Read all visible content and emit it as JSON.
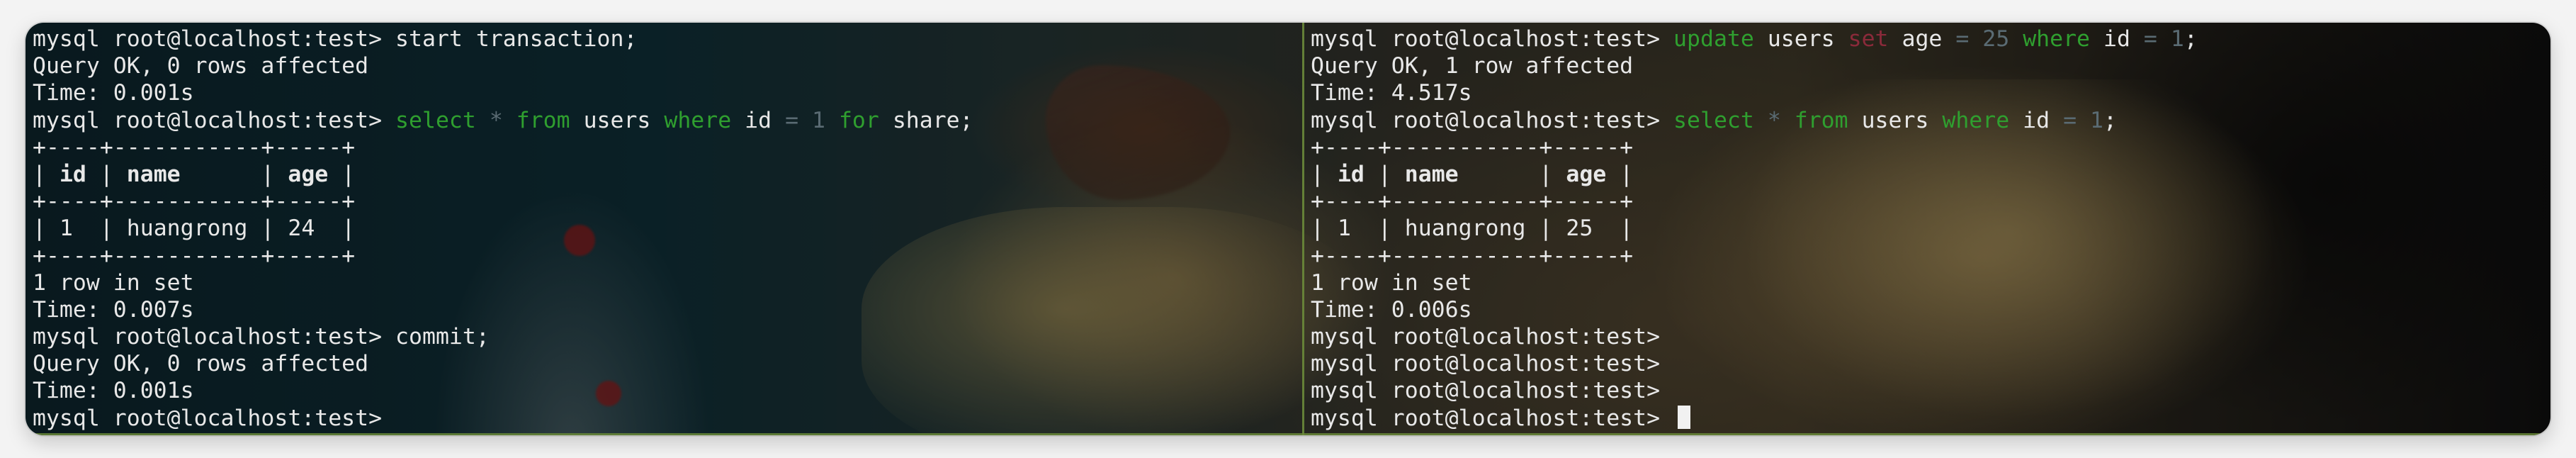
{
  "colors": {
    "text": "#e8e8e8",
    "keyword": "#2f9f2f",
    "number": "#5a6b73",
    "set_keyword": "#8a2a3a",
    "divider": "#6a8a3a",
    "cursor": "#f1f1f1"
  },
  "left": {
    "p1": "mysql root@localhost:test> ",
    "c1": "start transaction;",
    "o1": "Query OK, 0 rows affected",
    "t1": "Time: 0.001s",
    "p2": "mysql root@localhost:test> ",
    "q_select": "select",
    "q_star": "*",
    "q_from": "from",
    "q_users": "users",
    "q_where": "where",
    "q_id": "id",
    "q_eq": "=",
    "q_one": "1",
    "q_for": "for",
    "q_share": "share;",
    "border1": "+----+-----------+-----+",
    "h_id": "id",
    "h_name": "name",
    "h_age": "age",
    "border2": "+----+-----------+-----+",
    "r_id": "1",
    "r_name": "huangrong",
    "r_age": "24",
    "border3": "+----+-----------+-----+",
    "rows": "1 row in set",
    "t2": "Time: 0.007s",
    "p3": "mysql root@localhost:test> ",
    "c3": "commit;",
    "o3": "Query OK, 0 rows affected",
    "t3": "Time: 0.001s",
    "p4": "mysql root@localhost:test> "
  },
  "right": {
    "p1": "mysql root@localhost:test> ",
    "u_update": "update",
    "u_users": "users",
    "u_set": "set",
    "u_age": "age",
    "u_eq": "=",
    "u_val": "25",
    "u_where": "where",
    "u_id": "id",
    "u_eq2": "=",
    "u_one": "1",
    "u_semi": ";",
    "o1": "Query OK, 1 row affected",
    "t1": "Time: 4.517s",
    "p2": "mysql root@localhost:test> ",
    "q_select": "select",
    "q_star": "*",
    "q_from": "from",
    "q_users": "users",
    "q_where": "where",
    "q_id": "id",
    "q_eq": "=",
    "q_one": "1",
    "q_semi": ";",
    "border1": "+----+-----------+-----+",
    "h_id": "id",
    "h_name": "name",
    "h_age": "age",
    "border2": "+----+-----------+-----+",
    "r_id": "1",
    "r_name": "huangrong",
    "r_age": "25",
    "border3": "+----+-----------+-----+",
    "rows": "1 row in set",
    "t2": "Time: 0.006s",
    "p3": "mysql root@localhost:test>",
    "p4": "mysql root@localhost:test>",
    "p5": "mysql root@localhost:test>",
    "p6": "mysql root@localhost:test> "
  }
}
